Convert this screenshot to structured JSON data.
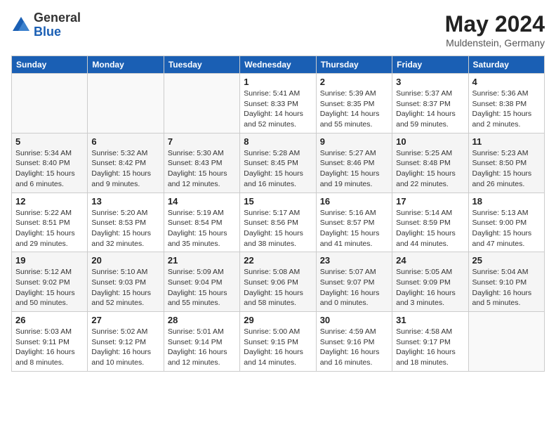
{
  "header": {
    "logo_general": "General",
    "logo_blue": "Blue",
    "title": "May 2024",
    "location": "Muldenstein, Germany"
  },
  "days_of_week": [
    "Sunday",
    "Monday",
    "Tuesday",
    "Wednesday",
    "Thursday",
    "Friday",
    "Saturday"
  ],
  "weeks": [
    [
      {
        "day": "",
        "info": ""
      },
      {
        "day": "",
        "info": ""
      },
      {
        "day": "",
        "info": ""
      },
      {
        "day": "1",
        "info": "Sunrise: 5:41 AM\nSunset: 8:33 PM\nDaylight: 14 hours\nand 52 minutes."
      },
      {
        "day": "2",
        "info": "Sunrise: 5:39 AM\nSunset: 8:35 PM\nDaylight: 14 hours\nand 55 minutes."
      },
      {
        "day": "3",
        "info": "Sunrise: 5:37 AM\nSunset: 8:37 PM\nDaylight: 14 hours\nand 59 minutes."
      },
      {
        "day": "4",
        "info": "Sunrise: 5:36 AM\nSunset: 8:38 PM\nDaylight: 15 hours\nand 2 minutes."
      }
    ],
    [
      {
        "day": "5",
        "info": "Sunrise: 5:34 AM\nSunset: 8:40 PM\nDaylight: 15 hours\nand 6 minutes."
      },
      {
        "day": "6",
        "info": "Sunrise: 5:32 AM\nSunset: 8:42 PM\nDaylight: 15 hours\nand 9 minutes."
      },
      {
        "day": "7",
        "info": "Sunrise: 5:30 AM\nSunset: 8:43 PM\nDaylight: 15 hours\nand 12 minutes."
      },
      {
        "day": "8",
        "info": "Sunrise: 5:28 AM\nSunset: 8:45 PM\nDaylight: 15 hours\nand 16 minutes."
      },
      {
        "day": "9",
        "info": "Sunrise: 5:27 AM\nSunset: 8:46 PM\nDaylight: 15 hours\nand 19 minutes."
      },
      {
        "day": "10",
        "info": "Sunrise: 5:25 AM\nSunset: 8:48 PM\nDaylight: 15 hours\nand 22 minutes."
      },
      {
        "day": "11",
        "info": "Sunrise: 5:23 AM\nSunset: 8:50 PM\nDaylight: 15 hours\nand 26 minutes."
      }
    ],
    [
      {
        "day": "12",
        "info": "Sunrise: 5:22 AM\nSunset: 8:51 PM\nDaylight: 15 hours\nand 29 minutes."
      },
      {
        "day": "13",
        "info": "Sunrise: 5:20 AM\nSunset: 8:53 PM\nDaylight: 15 hours\nand 32 minutes."
      },
      {
        "day": "14",
        "info": "Sunrise: 5:19 AM\nSunset: 8:54 PM\nDaylight: 15 hours\nand 35 minutes."
      },
      {
        "day": "15",
        "info": "Sunrise: 5:17 AM\nSunset: 8:56 PM\nDaylight: 15 hours\nand 38 minutes."
      },
      {
        "day": "16",
        "info": "Sunrise: 5:16 AM\nSunset: 8:57 PM\nDaylight: 15 hours\nand 41 minutes."
      },
      {
        "day": "17",
        "info": "Sunrise: 5:14 AM\nSunset: 8:59 PM\nDaylight: 15 hours\nand 44 minutes."
      },
      {
        "day": "18",
        "info": "Sunrise: 5:13 AM\nSunset: 9:00 PM\nDaylight: 15 hours\nand 47 minutes."
      }
    ],
    [
      {
        "day": "19",
        "info": "Sunrise: 5:12 AM\nSunset: 9:02 PM\nDaylight: 15 hours\nand 50 minutes."
      },
      {
        "day": "20",
        "info": "Sunrise: 5:10 AM\nSunset: 9:03 PM\nDaylight: 15 hours\nand 52 minutes."
      },
      {
        "day": "21",
        "info": "Sunrise: 5:09 AM\nSunset: 9:04 PM\nDaylight: 15 hours\nand 55 minutes."
      },
      {
        "day": "22",
        "info": "Sunrise: 5:08 AM\nSunset: 9:06 PM\nDaylight: 15 hours\nand 58 minutes."
      },
      {
        "day": "23",
        "info": "Sunrise: 5:07 AM\nSunset: 9:07 PM\nDaylight: 16 hours\nand 0 minutes."
      },
      {
        "day": "24",
        "info": "Sunrise: 5:05 AM\nSunset: 9:09 PM\nDaylight: 16 hours\nand 3 minutes."
      },
      {
        "day": "25",
        "info": "Sunrise: 5:04 AM\nSunset: 9:10 PM\nDaylight: 16 hours\nand 5 minutes."
      }
    ],
    [
      {
        "day": "26",
        "info": "Sunrise: 5:03 AM\nSunset: 9:11 PM\nDaylight: 16 hours\nand 8 minutes."
      },
      {
        "day": "27",
        "info": "Sunrise: 5:02 AM\nSunset: 9:12 PM\nDaylight: 16 hours\nand 10 minutes."
      },
      {
        "day": "28",
        "info": "Sunrise: 5:01 AM\nSunset: 9:14 PM\nDaylight: 16 hours\nand 12 minutes."
      },
      {
        "day": "29",
        "info": "Sunrise: 5:00 AM\nSunset: 9:15 PM\nDaylight: 16 hours\nand 14 minutes."
      },
      {
        "day": "30",
        "info": "Sunrise: 4:59 AM\nSunset: 9:16 PM\nDaylight: 16 hours\nand 16 minutes."
      },
      {
        "day": "31",
        "info": "Sunrise: 4:58 AM\nSunset: 9:17 PM\nDaylight: 16 hours\nand 18 minutes."
      },
      {
        "day": "",
        "info": ""
      }
    ]
  ]
}
